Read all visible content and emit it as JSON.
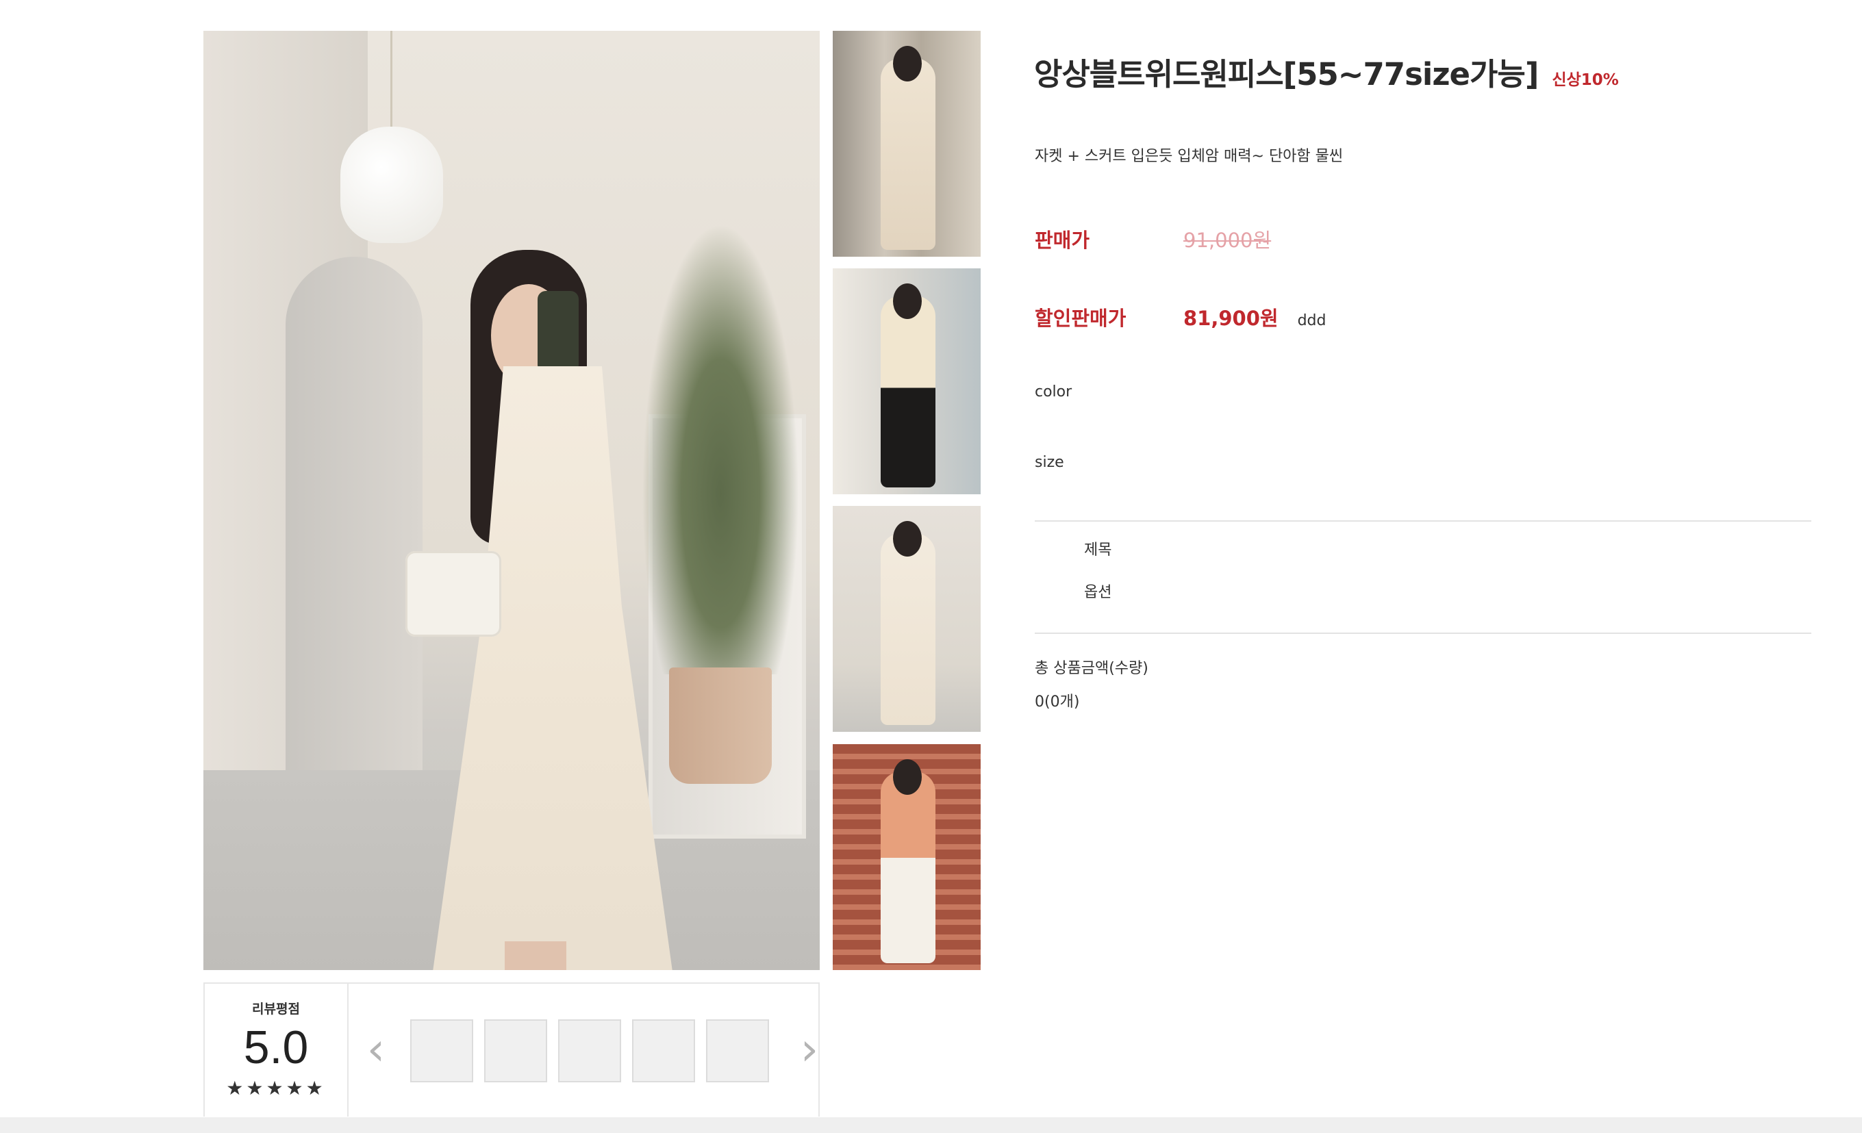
{
  "product": {
    "title": "앙상블트위드원피스[55~77size가능]",
    "badge": "신상10%",
    "summary": "자켓 + 스커트 입은듯 입체암 매력~ 단아함 물씬",
    "price_label": "판매가",
    "price": "91,000원",
    "sale_label": "할인판매가",
    "sale_price": "81,900원",
    "sale_note": "ddd"
  },
  "options": {
    "color_label": "color",
    "size_label": "size"
  },
  "selection": {
    "title_label": "제목",
    "option_label": "옵션"
  },
  "total": {
    "label": "총 상품금액(수량)",
    "value": "0(0개)"
  },
  "review": {
    "title": "리뷰평점",
    "score": "5.0",
    "stars": "★★★★★",
    "rating_value": 5.0,
    "prev_icon": "chevron-left-icon",
    "next_icon": "chevron-right-icon",
    "prev_glyph": "‹",
    "next_glyph": "›"
  },
  "colors": {
    "accent": "#c0282d",
    "strike_price": "#e5a2a7"
  }
}
